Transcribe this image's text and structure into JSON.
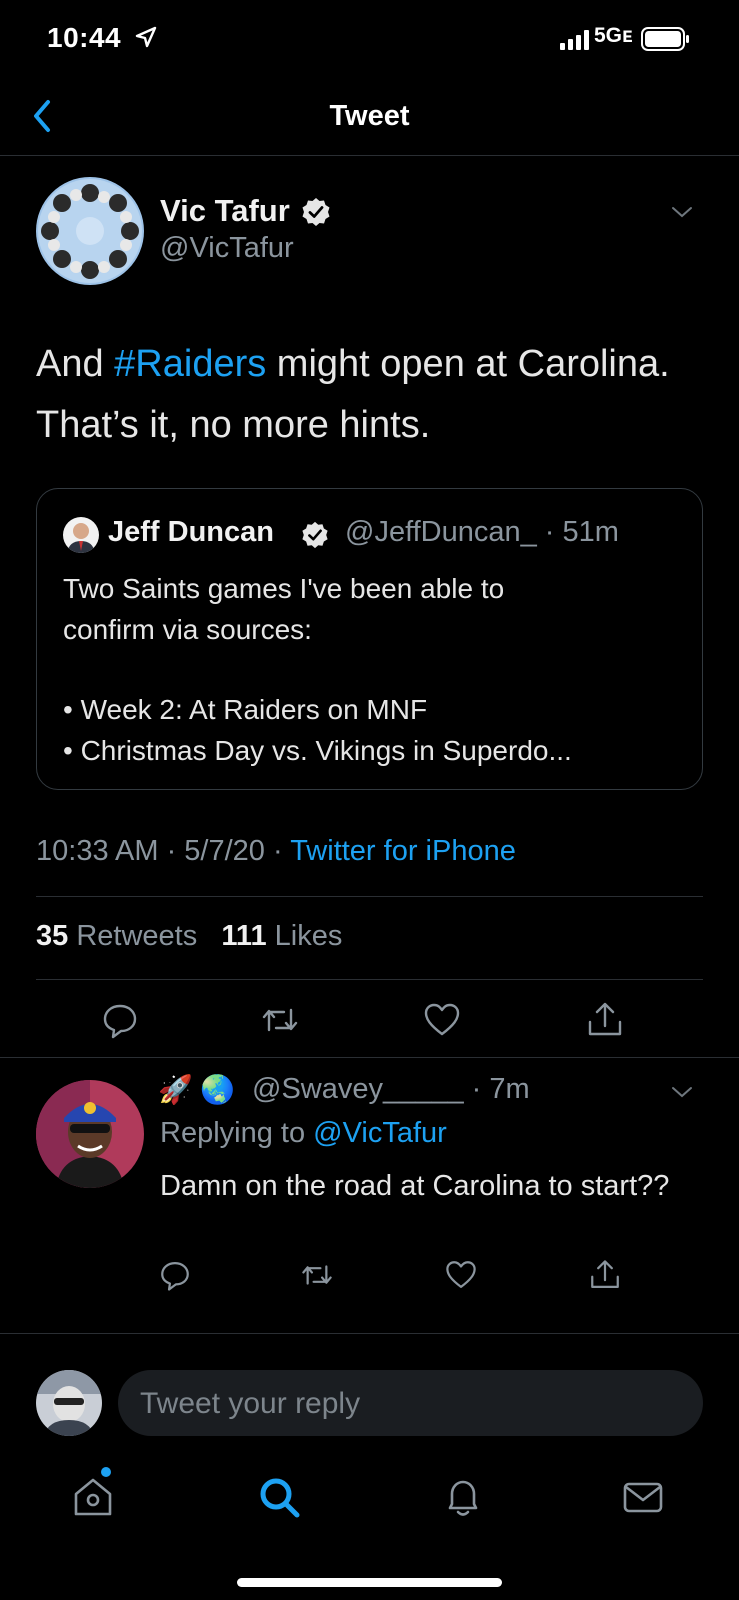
{
  "status_bar": {
    "time": "10:44",
    "network": "5Gᴇ"
  },
  "nav": {
    "title": "Tweet"
  },
  "tweet": {
    "author_name": "Vic Tafur",
    "handle": "@VicTafur",
    "text_before": "And ",
    "hashtag": "#Raiders",
    "text_after": " might open at Carolina. That’s it, no more hints.",
    "quote": {
      "author_name": "Jeff Duncan",
      "meta": "@JeffDuncan_ · 51m",
      "line1": "Two Saints games I've been able to",
      "line2": "confirm via sources:",
      "line3": "• Week 2: At Raiders on MNF",
      "line4": "• Christmas Day vs. Vikings in Superdo..."
    },
    "timestamp": "10:33 AM · 5/7/20 · ",
    "source": "Twitter for iPhone",
    "retweets_count": "35",
    "retweets_label": " Retweets",
    "likes_count": "111",
    "likes_label": " Likes"
  },
  "reply": {
    "emoji1": "🚀",
    "emoji2": "🌏",
    "handle_meta": "@Swavey_____ · 7m",
    "replying_prefix": "Replying to ",
    "replying_mention": "@VicTafur",
    "text": "Damn on the road at Carolina to start??"
  },
  "composer": {
    "placeholder": "Tweet your reply"
  },
  "colors": {
    "accent": "#1da1f2",
    "background": "#000000",
    "muted": "#8b959e"
  },
  "icons": [
    "reply-icon",
    "retweet-icon",
    "like-icon",
    "share-icon",
    "home-icon",
    "search-icon",
    "notifications-icon",
    "messages-icon"
  ]
}
